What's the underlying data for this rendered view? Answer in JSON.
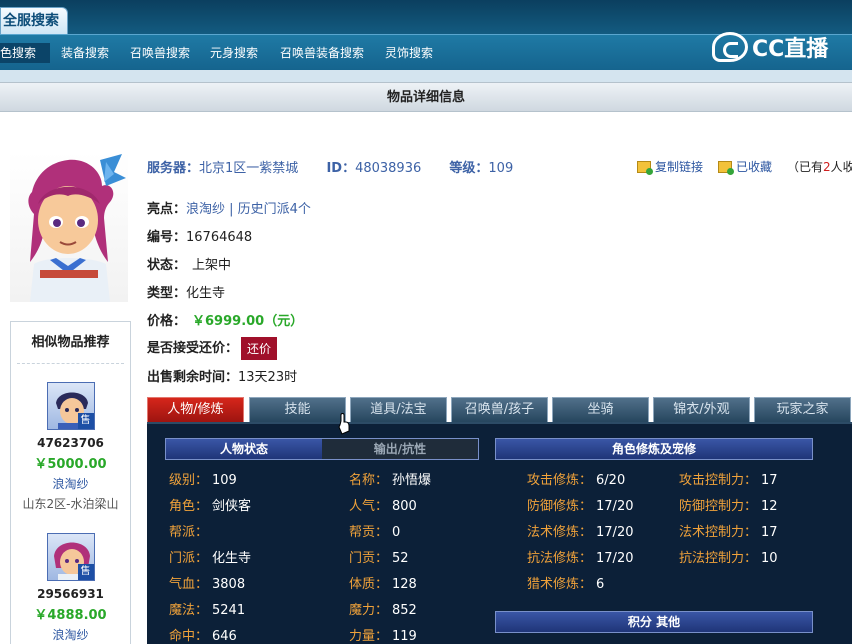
{
  "nav": {
    "main_tab": "全服搜索",
    "items": [
      "角色搜索",
      "装备搜索",
      "召唤兽搜索",
      "元身搜索",
      "召唤兽装备搜索",
      "灵饰搜索"
    ],
    "logo_text": "CC直播"
  },
  "title": "物品详细信息",
  "item": {
    "server_label": "服务器：",
    "server": "北京1区一紫禁城",
    "id_label": "ID：",
    "id": "48038936",
    "level_label": "等级：",
    "level": "109",
    "copy_link": "复制链接",
    "favorited": "已收藏",
    "fav_prefix": "（已有",
    "fav_count": "2",
    "fav_suffix": "人收藏",
    "highlight_label": "亮点：",
    "highlight": "浪淘纱 | 历史门派4个",
    "number_label": "编号：",
    "number": "16764648",
    "status_label": "状态：",
    "status": "上架中",
    "type_label": "类型：",
    "type": "化生寺",
    "price_label": "价格：",
    "price": "￥6999.00（元）",
    "bargain_label": "是否接受还价：",
    "bargain_button": "还价",
    "time_label": "出售剩余时间：",
    "time_left": "13天23时"
  },
  "sidebar": {
    "title": "相似物品推荐",
    "items": [
      {
        "id": "47623706",
        "price": "￥5000.00",
        "name": "浪淘纱",
        "server": "山东2区-水泊梁山",
        "badge": "售"
      },
      {
        "id": "29566931",
        "price": "￥4888.00",
        "name": "浪淘纱",
        "badge": "售"
      }
    ]
  },
  "tabs": [
    "人物/修炼",
    "技能",
    "道具/法宝",
    "召唤兽/孩子",
    "坐骑",
    "锦衣/外观",
    "玩家之家"
  ],
  "panel": {
    "status_head": "人物状态",
    "attr_head": "输出/抗性",
    "cultivation_head": "角色修炼及宠修",
    "score_head": "积分 其他",
    "left_col": [
      {
        "k": "级别：",
        "v": "109"
      },
      {
        "k": "角色：",
        "v": "剑侠客"
      },
      {
        "k": "帮派：",
        "v": ""
      },
      {
        "k": "门派：",
        "v": "化生寺"
      },
      {
        "k": "气血：",
        "v": "3808"
      },
      {
        "k": "魔法：",
        "v": "5241"
      },
      {
        "k": "命中：",
        "v": "646"
      }
    ],
    "mid_col": [
      {
        "k": "名称：",
        "v": "孙悟爆"
      },
      {
        "k": "人气：",
        "v": "800"
      },
      {
        "k": "帮贡：",
        "v": "0"
      },
      {
        "k": "门贡：",
        "v": "52"
      },
      {
        "k": "体质：",
        "v": "128"
      },
      {
        "k": "魔力：",
        "v": "852"
      },
      {
        "k": "力量：",
        "v": "119"
      }
    ],
    "cult_col1": [
      {
        "k": "攻击修炼：",
        "v": "6/20"
      },
      {
        "k": "防御修炼：",
        "v": "17/20"
      },
      {
        "k": "法术修炼：",
        "v": "17/20"
      },
      {
        "k": "抗法修炼：",
        "v": "17/20"
      },
      {
        "k": "猎术修炼：",
        "v": "6"
      }
    ],
    "cult_col2": [
      {
        "k": "攻击控制力：",
        "v": "17"
      },
      {
        "k": "防御控制力：",
        "v": "12"
      },
      {
        "k": "法术控制力：",
        "v": "17"
      },
      {
        "k": "抗法控制力：",
        "v": "10"
      }
    ]
  }
}
